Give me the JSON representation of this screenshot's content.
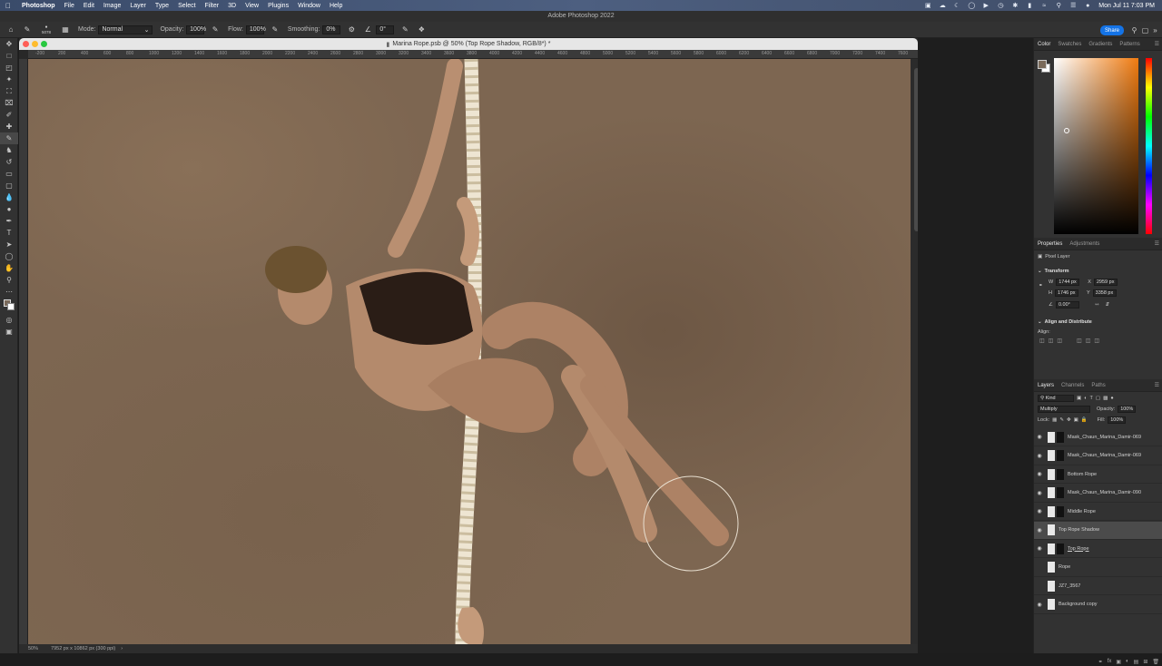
{
  "menubar": {
    "app": "Photoshop",
    "items": [
      "File",
      "Edit",
      "Image",
      "Layer",
      "Type",
      "Select",
      "Filter",
      "3D",
      "View",
      "Plugins",
      "Window",
      "Help"
    ],
    "clock": "Mon Jul 11  7:03 PM"
  },
  "app_title": "Adobe Photoshop 2022",
  "options": {
    "brush_size": "5078",
    "mode_label": "Mode:",
    "mode_value": "Normal",
    "opacity_label": "Opacity:",
    "opacity_value": "100%",
    "flow_label": "Flow:",
    "flow_value": "100%",
    "smoothing_label": "Smoothing:",
    "smoothing_value": "0%",
    "angle_value": "0°",
    "share_label": "Share"
  },
  "document": {
    "tab_title": "Marina Rope.psb @ 50% (Top Rope Shadow, RGB/8*) *",
    "ruler_ticks": [
      "-200",
      "200",
      "400",
      "600",
      "800",
      "1000",
      "1200",
      "1400",
      "1600",
      "1800",
      "2000",
      "2200",
      "2400",
      "2600",
      "2800",
      "3000",
      "3200",
      "3400",
      "3600",
      "3800",
      "4000",
      "4200",
      "4400",
      "4600",
      "4800",
      "5000",
      "5200",
      "5400",
      "5600",
      "5800",
      "6000",
      "6200",
      "6400",
      "6600",
      "6800",
      "7000",
      "7200",
      "7400",
      "7600"
    ],
    "zoom": "50%",
    "doc_info": "7952 px x 10862 px (300 ppi)"
  },
  "color_panel": {
    "tabs": [
      "Color",
      "Swatches",
      "Gradients",
      "Patterns"
    ],
    "foreground": "#7a6a5a",
    "background": "#ffffff"
  },
  "properties": {
    "tabs": [
      "Properties",
      "Adjustments"
    ],
    "kind": "Pixel Layer",
    "transform_title": "Transform",
    "w_label": "W",
    "w_value": "1744 px",
    "h_label": "H",
    "h_value": "1746 px",
    "x_label": "X",
    "x_value": "2959 px",
    "y_label": "Y",
    "y_value": "3358 px",
    "angle_value": "0.00°",
    "align_title": "Align and Distribute",
    "align_label": "Align:"
  },
  "layers_panel": {
    "tabs": [
      "Layers",
      "Channels",
      "Paths"
    ],
    "kind_filter": "Kind",
    "blend_mode": "Multiply",
    "opacity_label": "Opacity:",
    "opacity_value": "100%",
    "lock_label": "Lock:",
    "fill_label": "Fill:",
    "fill_value": "100%",
    "layers": [
      {
        "name": "Mask_Chaun_Marina_Damir-069",
        "visible": true,
        "selected": false
      },
      {
        "name": "Mask_Chaun_Marina_Damir-069",
        "visible": true,
        "selected": false
      },
      {
        "name": "Bottom Rope",
        "visible": true,
        "selected": false
      },
      {
        "name": "Mask_Chaun_Marina_Damir-090",
        "visible": true,
        "selected": false
      },
      {
        "name": "Middle Rope",
        "visible": true,
        "selected": false
      },
      {
        "name": "Top Rope Shadow",
        "visible": true,
        "selected": true
      },
      {
        "name": "Top Rope",
        "visible": true,
        "selected": false
      },
      {
        "name": "Rope",
        "visible": false,
        "selected": false
      },
      {
        "name": "JZ7_3567",
        "visible": false,
        "selected": false
      },
      {
        "name": "Background copy",
        "visible": true,
        "selected": false
      }
    ]
  },
  "colors": {
    "accent": "#1473e6",
    "canvas_bg": "#7d6651",
    "panel_bg": "#323232"
  }
}
